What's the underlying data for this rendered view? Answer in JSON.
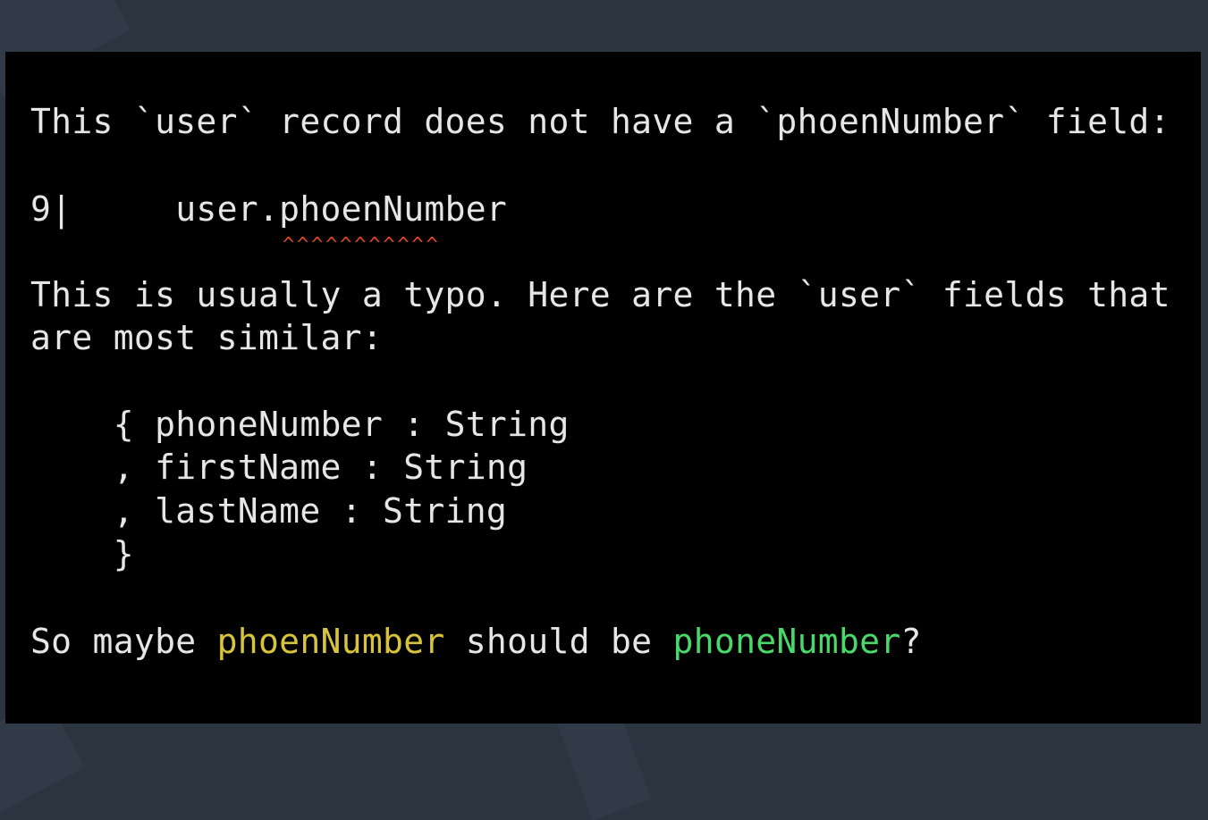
{
  "terminal": {
    "header_line": "This `user` record does not have a `phoenNumber` field:",
    "code_line_number": "9|",
    "code_indent": "     ",
    "code_text": "user.phoenNumber",
    "caret_marks": "^^^^^^^^^^^",
    "hint_line_1": "This is usually a typo. Here are the `user` fields that",
    "hint_line_2": "are most similar:",
    "fields": [
      {
        "prefix": "    { ",
        "text": "phoneNumber : String"
      },
      {
        "prefix": "    , ",
        "text": "firstName : String"
      },
      {
        "prefix": "    , ",
        "text": "lastName : String"
      }
    ],
    "closing_brace": "    }",
    "suggestion": {
      "prefix": "So maybe ",
      "wrong": "phoenNumber",
      "middle": " should be ",
      "right": "phoneNumber",
      "suffix": "?"
    },
    "colors": {
      "background": "#000000",
      "text": "#e6e6e6",
      "caret": "#e2452c",
      "wrong_highlight": "#d7c43a",
      "right_highlight": "#49d96a"
    }
  }
}
